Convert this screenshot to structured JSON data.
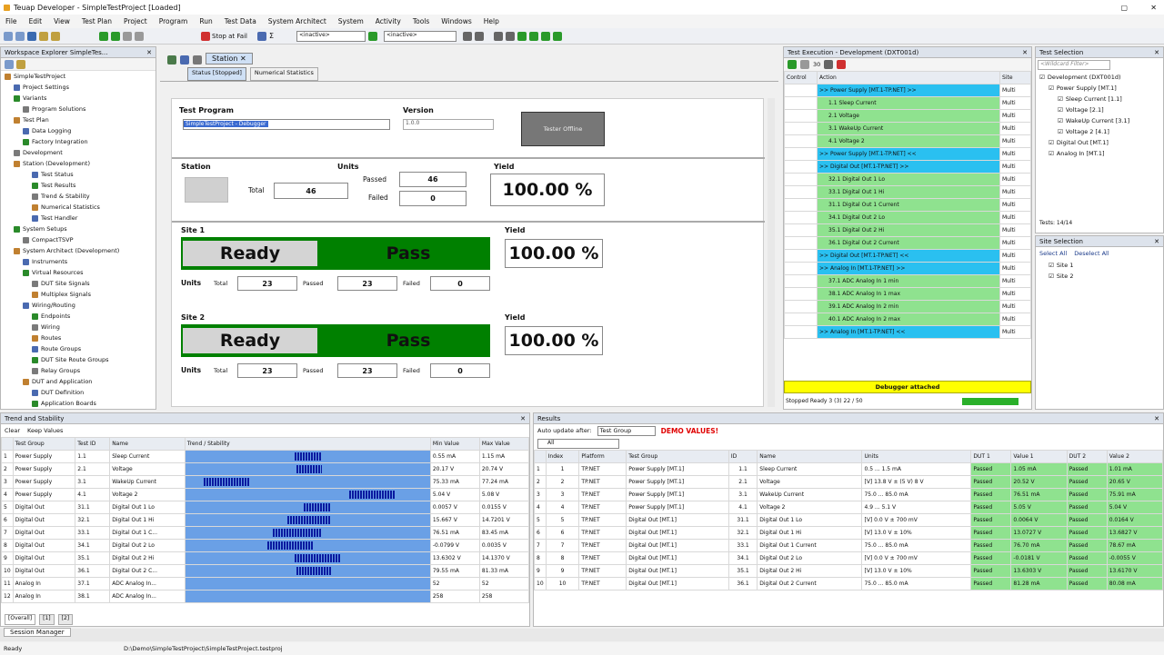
{
  "title": "Teuap Developer - SimpleTestProject [Loaded]",
  "menu": [
    "File",
    "Edit",
    "View",
    "Test Plan",
    "Project",
    "Program",
    "Run",
    "Test Data",
    "System Architect",
    "System",
    "Activity",
    "Tools",
    "Windows",
    "Help"
  ],
  "toolbar": {
    "stop_label": "Stop at Fail",
    "inactive1": "<inactive>",
    "inactive2": "<inactive>"
  },
  "workspace": {
    "title": "Workspace Explorer  SimpleTes...",
    "items": [
      "SimpleTestProject",
      "Project Settings",
      "Variants",
      "Program Solutions",
      "Test Plan",
      "Data Logging",
      "Factory Integration",
      "Development",
      "Station (Development)",
      "Test Status",
      "Test Results",
      "Trend & Stability",
      "Numerical Statistics",
      "Test Handler",
      "System Setups",
      "CompactTSVP",
      "System Architect (Development)",
      "Instruments",
      "Virtual Resources",
      "DUT Site Signals",
      "Multiplex Signals",
      "Wiring/Routing",
      "Endpoints",
      "Wiring",
      "Routes",
      "Route Groups",
      "DUT Site Route Groups",
      "Relay Groups",
      "DUT and Application",
      "DUT Definition",
      "Application Boards"
    ]
  },
  "doc_tab": "Station",
  "subtabs": [
    "Status [Stopped]",
    "Numerical Statistics"
  ],
  "station": {
    "tp_label": "Test Program",
    "tp_value": "SimpleTestProject - Debugger",
    "ver_label": "Version",
    "ver_value": "1.0.0",
    "tester": "Tester Offline",
    "station_label": "Station",
    "units_label": "Units",
    "total_label": "Total",
    "total": "46",
    "passed_label": "Passed",
    "passed": "46",
    "failed_label": "Failed",
    "failed": "0",
    "yield_label": "Yield",
    "yield": "100.00 %"
  },
  "sites": [
    {
      "name": "Site 1",
      "state": "Ready",
      "result": "Pass",
      "yield_label": "Yield",
      "yield": "100.00 %",
      "units": "Units",
      "total_l": "Total",
      "total": "23",
      "passed_l": "Passed",
      "passed": "23",
      "failed_l": "Failed",
      "failed": "0"
    },
    {
      "name": "Site 2",
      "state": "Ready",
      "result": "Pass",
      "yield_label": "Yield",
      "yield": "100.00 %",
      "units": "Units",
      "total_l": "Total",
      "total": "23",
      "passed_l": "Passed",
      "passed": "23",
      "failed_l": "Failed",
      "failed": "0"
    }
  ],
  "exec": {
    "title": "Test Execution - Development (DXT001d)",
    "count": "30",
    "cols": [
      "Control",
      "Action",
      "Site"
    ],
    "rows": [
      {
        "a": ">> Power Supply [MT.1-TP.NET] >>",
        "s": "Multi",
        "t": "b"
      },
      {
        "a": "1.1 Sleep Current",
        "s": "Multi",
        "t": "g"
      },
      {
        "a": "2.1 Voltage",
        "s": "Multi",
        "t": "g"
      },
      {
        "a": "3.1 WakeUp Current",
        "s": "Multi",
        "t": "g"
      },
      {
        "a": "4.1 Voltage 2",
        "s": "Multi",
        "t": "g"
      },
      {
        "a": ">> Power Supply [MT.1-TP.NET] <<",
        "s": "Multi",
        "t": "b"
      },
      {
        "a": ">> Digital Out [MT.1-TP.NET] >>",
        "s": "Multi",
        "t": "b"
      },
      {
        "a": "32.1 Digital Out 1 Lo",
        "s": "Multi",
        "t": "g"
      },
      {
        "a": "33.1 Digital Out 1 Hi",
        "s": "Multi",
        "t": "g"
      },
      {
        "a": "31.1 Digital Out 1 Current",
        "s": "Multi",
        "t": "g"
      },
      {
        "a": "34.1 Digital Out 2 Lo",
        "s": "Multi",
        "t": "g"
      },
      {
        "a": "35.1 Digital Out 2 Hi",
        "s": "Multi",
        "t": "g"
      },
      {
        "a": "36.1 Digital Out 2 Current",
        "s": "Multi",
        "t": "g"
      },
      {
        "a": ">> Digital Out [MT.1-TP.NET] <<",
        "s": "Multi",
        "t": "b"
      },
      {
        "a": ">> Analog In [MT.1-TP.NET] >>",
        "s": "Multi",
        "t": "b"
      },
      {
        "a": "37.1 ADC Analog In 1 min",
        "s": "Multi",
        "t": "g"
      },
      {
        "a": "38.1 ADC Analog In 1 max",
        "s": "Multi",
        "t": "g"
      },
      {
        "a": "39.1 ADC Analog In 2 min",
        "s": "Multi",
        "t": "g"
      },
      {
        "a": "40.1 ADC Analog In 2 max",
        "s": "Multi",
        "t": "g"
      },
      {
        "a": ">> Analog In [MT.1-TP.NET] <<",
        "s": "Multi",
        "t": "b"
      }
    ],
    "debugger": "Debugger attached",
    "status": "Stopped Ready 3 (3)   22 / 50"
  },
  "testsel": {
    "title": "Test Selection",
    "filter": "<Wildcard Filter>",
    "items": [
      "Development (DXT001d)",
      "Power Supply [MT.1]",
      "Sleep Current [1.1]",
      "Voltage [2.1]",
      "WakeUp Current [3.1]",
      "Voltage 2 [4.1]",
      "Digital Out [MT.1]",
      "Analog In [MT.1]"
    ],
    "tests": "Tests: 14/14"
  },
  "sitesel": {
    "title": "Site Selection",
    "select_all": "Select All",
    "deselect_all": "Deselect All",
    "sites": [
      "Site 1",
      "Site 2"
    ]
  },
  "trend": {
    "title": "Trend and Stability",
    "clear": "Clear",
    "keep": "Keep Values",
    "cols": [
      "Test Group",
      "Test ID",
      "Name",
      "Trend / Stability",
      "Min Value",
      "Max Value"
    ],
    "rows": [
      [
        "Power Supply",
        "1.1",
        "Sleep Current",
        "",
        "0.55 mA",
        "1.15 mA"
      ],
      [
        "Power Supply",
        "2.1",
        "Voltage",
        "",
        "20.17 V",
        "20.74 V"
      ],
      [
        "Power Supply",
        "3.1",
        "WakeUp Current",
        "",
        "75.33 mA",
        "77.24 mA"
      ],
      [
        "Power Supply",
        "4.1",
        "Voltage 2",
        "",
        "5.04 V",
        "5.08 V"
      ],
      [
        "Digital Out",
        "31.1",
        "Digital Out 1 Lo",
        "",
        "0.0057 V",
        "0.0155 V"
      ],
      [
        "Digital Out",
        "32.1",
        "Digital Out 1 Hi",
        "",
        "15.667 V",
        "14.7201 V"
      ],
      [
        "Digital Out",
        "33.1",
        "Digital Out 1 C...",
        "",
        "76.51 mA",
        "83.45 mA"
      ],
      [
        "Digital Out",
        "34.1",
        "Digital Out 2 Lo",
        "",
        "-0.0799 V",
        "0.0035 V"
      ],
      [
        "Digital Out",
        "35.1",
        "Digital Out 2 Hi",
        "",
        "13.6302 V",
        "14.1370 V"
      ],
      [
        "Digital Out",
        "36.1",
        "Digital Out 2 C...",
        "",
        "79.55 mA",
        "81.33 mA"
      ],
      [
        "Analog In",
        "37.1",
        "ADC Analog In...",
        "",
        "52",
        "52"
      ],
      [
        "Analog In",
        "38.1",
        "ADC Analog In...",
        "",
        "258",
        "258"
      ]
    ],
    "tabs": [
      "[Overall]",
      "[1]",
      "[2]"
    ]
  },
  "results": {
    "title": "Results",
    "auto": "Auto update after:",
    "group": "Test Group",
    "demo": "DEMO VALUES!",
    "filter": "All",
    "cols": [
      "Index",
      "Platform",
      "Test Group",
      "ID",
      "Name",
      "Units",
      "DUT 1",
      "Value 1",
      "DUT 2",
      "Value 2"
    ],
    "rows": [
      [
        "1",
        "TP.NET",
        "Power Supply [MT.1]",
        "1.1",
        "Sleep Current",
        "0.5 ... 1.5 mA",
        "Passed",
        "1.05 mA",
        "Passed",
        "1.01 mA"
      ],
      [
        "2",
        "TP.NET",
        "Power Supply [MT.1]",
        "2.1",
        "Voltage",
        "[V] 13.8 V ± (5 V) 8 V",
        "Passed",
        "20.52 V",
        "Passed",
        "20.65 V"
      ],
      [
        "3",
        "TP.NET",
        "Power Supply [MT.1]",
        "3.1",
        "WakeUp Current",
        "75.0 ... 85.0 mA",
        "Passed",
        "76.51 mA",
        "Passed",
        "75.91 mA"
      ],
      [
        "4",
        "TP.NET",
        "Power Supply [MT.1]",
        "4.1",
        "Voltage 2",
        "4.9 ... 5.1 V",
        "Passed",
        "5.05 V",
        "Passed",
        "5.04 V"
      ],
      [
        "5",
        "TP.NET",
        "Digital Out [MT.1]",
        "31.1",
        "Digital Out 1 Lo",
        "[V] 0.0 V ± 700 mV",
        "Passed",
        "0.0064 V",
        "Passed",
        "0.0164 V"
      ],
      [
        "6",
        "TP.NET",
        "Digital Out [MT.1]",
        "32.1",
        "Digital Out 1 Hi",
        "[V] 13.0 V ± 10%",
        "Passed",
        "13.0727 V",
        "Passed",
        "13.6827 V"
      ],
      [
        "7",
        "TP.NET",
        "Digital Out [MT.1]",
        "33.1",
        "Digital Out 1 Current",
        "75.0 ... 85.0 mA",
        "Passed",
        "76.70 mA",
        "Passed",
        "78.67 mA"
      ],
      [
        "8",
        "TP.NET",
        "Digital Out [MT.1]",
        "34.1",
        "Digital Out 2 Lo",
        "[V] 0.0 V ± 700 mV",
        "Passed",
        "-0.0181 V",
        "Passed",
        "-0.0055 V"
      ],
      [
        "9",
        "TP.NET",
        "Digital Out [MT.1]",
        "35.1",
        "Digital Out 2 Hi",
        "[V] 13.0 V ± 10%",
        "Passed",
        "13.6303 V",
        "Passed",
        "13.6170 V"
      ],
      [
        "10",
        "TP.NET",
        "Digital Out [MT.1]",
        "36.1",
        "Digital Out 2 Current",
        "75.0 ... 85.0 mA",
        "Passed",
        "81.28 mA",
        "Passed",
        "80.08 mA"
      ]
    ]
  },
  "session": "Session Manager",
  "statusbar": {
    "state": "Ready",
    "path": "D:\\Demo\\SimpleTestProject\\SimpleTestProject.testproj"
  },
  "colors": {
    "green": "#008000",
    "pass_cell": "#8fe28f",
    "blue_row": "#2ac0f0",
    "yellow": "#ffff00",
    "demo_red": "#e00000"
  }
}
